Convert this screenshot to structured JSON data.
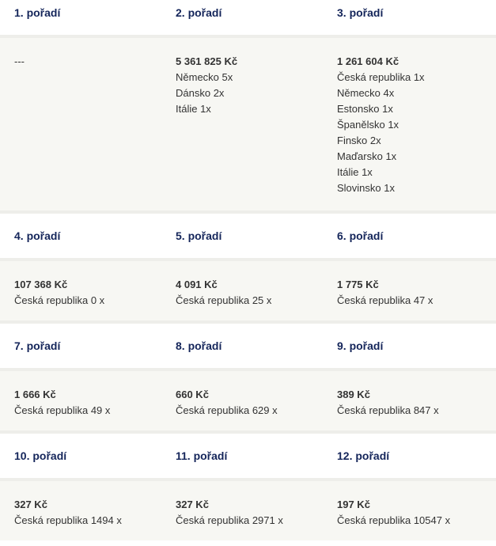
{
  "groups": [
    {
      "headers": [
        "1. pořadí",
        "2. pořadí",
        "3. pořadí"
      ],
      "cells": [
        {
          "amount": "---",
          "lines": []
        },
        {
          "amount": "5 361 825 Kč",
          "lines": [
            "Německo 5x",
            "Dánsko 2x",
            "Itálie 1x"
          ]
        },
        {
          "amount": "1 261 604 Kč",
          "lines": [
            "Česká republika 1x",
            "Německo 4x",
            "Estonsko 1x",
            "Španělsko 1x",
            "Finsko 2x",
            "Maďarsko 1x",
            "Itálie 1x",
            "Slovinsko 1x"
          ]
        }
      ]
    },
    {
      "headers": [
        "4. pořadí",
        "5. pořadí",
        "6. pořadí"
      ],
      "cells": [
        {
          "amount": "107 368 Kč",
          "lines": [
            "Česká republika 0 x"
          ]
        },
        {
          "amount": "4 091 Kč",
          "lines": [
            "Česká republika 25 x"
          ]
        },
        {
          "amount": "1 775 Kč",
          "lines": [
            "Česká republika 47 x"
          ]
        }
      ]
    },
    {
      "headers": [
        "7. pořadí",
        "8. pořadí",
        "9. pořadí"
      ],
      "cells": [
        {
          "amount": "1 666 Kč",
          "lines": [
            "Česká republika 49 x"
          ]
        },
        {
          "amount": "660 Kč",
          "lines": [
            "Česká republika 629 x"
          ]
        },
        {
          "amount": "389 Kč",
          "lines": [
            "Česká republika 847 x"
          ]
        }
      ]
    },
    {
      "headers": [
        "10. pořadí",
        "11. pořadí",
        "12. pořadí"
      ],
      "cells": [
        {
          "amount": "327 Kč",
          "lines": [
            "Česká republika 1494 x"
          ]
        },
        {
          "amount": "327 Kč",
          "lines": [
            "Česká republika 2971 x"
          ]
        },
        {
          "amount": "197 Kč",
          "lines": [
            "Česká republika 10547 x"
          ]
        }
      ]
    }
  ]
}
